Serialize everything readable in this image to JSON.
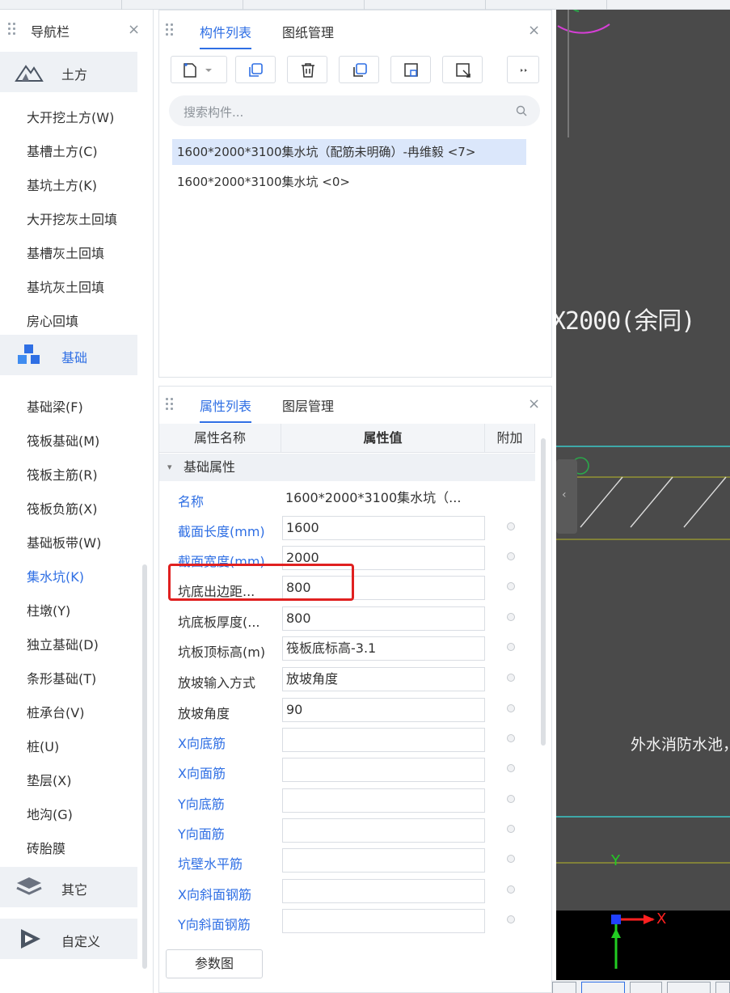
{
  "nav": {
    "title": "导航栏",
    "close_icon": "close-icon",
    "categories": [
      {
        "label": "土方",
        "icon": "earthwork-icon"
      },
      {
        "label": "基础",
        "icon": "foundation-icon"
      },
      {
        "label": "其它",
        "icon": "layers-icon"
      },
      {
        "label": "自定义",
        "icon": "custom-icon"
      }
    ],
    "earthwork_items": [
      "大开挖土方(W)",
      "基槽土方(C)",
      "基坑土方(K)",
      "大开挖灰土回填",
      "基槽灰土回填",
      "基坑灰土回填",
      "房心回填"
    ],
    "foundation_items": [
      "基础梁(F)",
      "筏板基础(M)",
      "筏板主筋(R)",
      "筏板负筋(X)",
      "基础板带(W)",
      "集水坑(K)",
      "柱墩(Y)",
      "独立基础(D)",
      "条形基础(T)",
      "桩承台(V)",
      "桩(U)",
      "垫层(X)",
      "地沟(G)",
      "砖胎膜"
    ],
    "selected_item": "集水坑(K)"
  },
  "component_panel": {
    "tabs": [
      "构件列表",
      "图纸管理"
    ],
    "active_tab": "构件列表",
    "toolbar": [
      "new-icon",
      "dropdown-icon",
      "copy-icon",
      "delete-icon",
      "copy-to-floor-icon",
      "save-icon",
      "export-icon",
      "more-icon"
    ],
    "search_placeholder": "搜索构件...",
    "items": [
      "1600*2000*3100集水坑（配筋未明确）-冉维毅 <7>",
      "1600*2000*3100集水坑 <0>"
    ]
  },
  "property_panel": {
    "tabs": [
      "属性列表",
      "图层管理"
    ],
    "active_tab": "属性列表",
    "columns": [
      "属性名称",
      "属性值",
      "附加"
    ],
    "group": "基础属性",
    "rows": [
      {
        "name": "名称",
        "value": "1600*2000*3100集水坑（..."
      },
      {
        "name": "截面长度(mm)",
        "value": "1600"
      },
      {
        "name": "截面宽度(mm)",
        "value": "2000"
      },
      {
        "name": "坑底出边距...",
        "value": "800"
      },
      {
        "name": "坑底板厚度(...",
        "value": "800"
      },
      {
        "name": "坑板顶标高(m)",
        "value": "筏板底标高-3.1"
      },
      {
        "name": "放坡输入方式",
        "value": "放坡角度"
      },
      {
        "name": "放坡角度",
        "value": "90"
      },
      {
        "name": "X向底筋",
        "value": ""
      },
      {
        "name": "X向面筋",
        "value": ""
      },
      {
        "name": "Y向底筋",
        "value": ""
      },
      {
        "name": "Y向面筋",
        "value": ""
      },
      {
        "name": "坑壁水平筋",
        "value": ""
      },
      {
        "name": "X向斜面钢筋",
        "value": ""
      },
      {
        "name": "Y向斜面钢筋",
        "value": ""
      }
    ],
    "param_button": "参数图"
  },
  "canvas": {
    "text_1": "X2000(余同)",
    "text_2": "外水消防水池，板",
    "axis_y": "Y",
    "axis_x": "X"
  },
  "colors": {
    "accent": "#2f6fe4",
    "highlight": "#e02020",
    "canvas_bg": "#4a4a4a"
  }
}
